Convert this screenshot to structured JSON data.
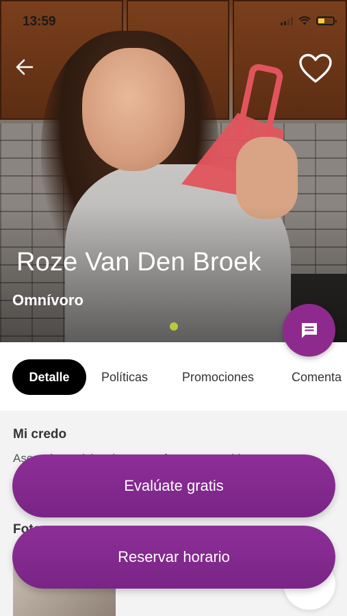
{
  "status_bar": {
    "time": "13:59"
  },
  "profile": {
    "name": "Roze Van Den Broek",
    "diet": "Omnívoro"
  },
  "carousel": {
    "current": 1,
    "total": 1
  },
  "tabs": [
    {
      "label": "Detalle",
      "active": true
    },
    {
      "label": "Políticas",
      "active": false
    },
    {
      "label": "Promociones",
      "active": false
    },
    {
      "label": "Comenta",
      "active": false
    }
  ],
  "detail": {
    "section_title": "Mi credo",
    "section_text": "Asesoría nutricional para conformar y cambiar",
    "photos_title": "Fotos"
  },
  "actions": {
    "evaluate_label": "Evalúate gratis",
    "reserve_label": "Reservar horario"
  },
  "colors": {
    "accent": "#8e2a8e",
    "indicator": "#b9c93a",
    "active_tab": "#000000"
  },
  "icons": [
    "back-arrow-icon",
    "heart-icon",
    "chat-icon"
  ]
}
